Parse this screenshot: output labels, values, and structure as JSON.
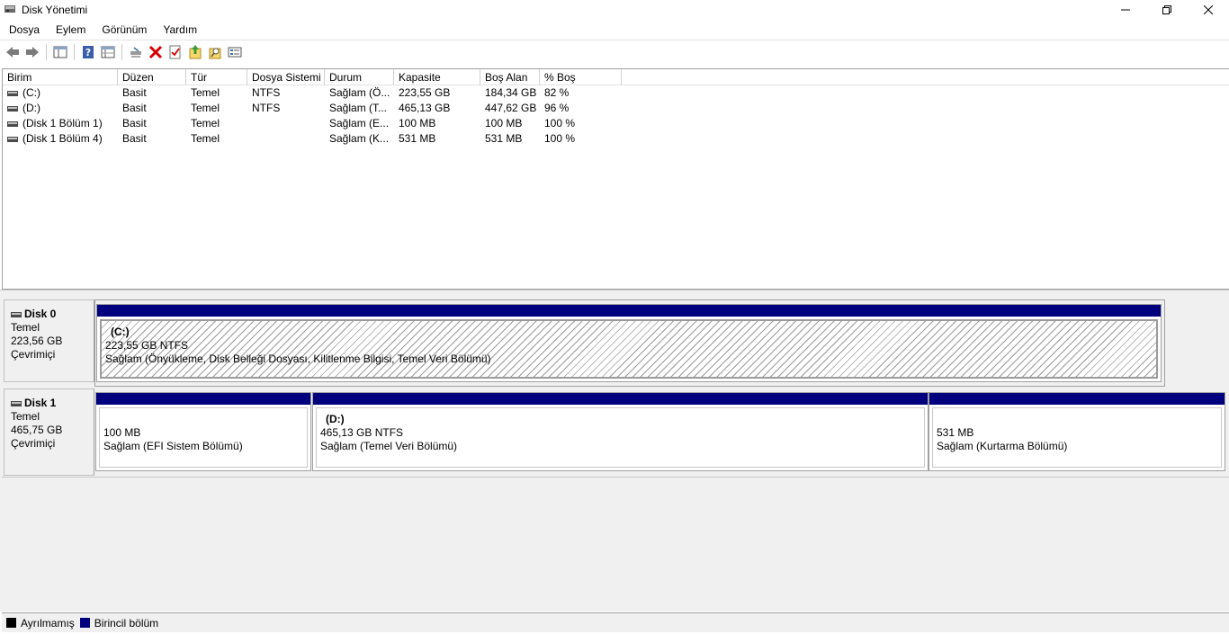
{
  "window": {
    "title": "Disk Yönetimi"
  },
  "menu": [
    "Dosya",
    "Eylem",
    "Görünüm",
    "Yardım"
  ],
  "toolbar": {
    "buttons": [
      "back-arrow-icon",
      "forward-arrow-icon",
      "console-tree-icon",
      "help-icon",
      "properties-grid-icon",
      "connect-disk-icon",
      "delete-icon",
      "check-icon",
      "export-icon",
      "find-icon",
      "list-view-icon"
    ]
  },
  "colors": {
    "primary_partition": "#00007f",
    "unallocated": "#000000"
  },
  "volume_list": {
    "columns": [
      "Birim",
      "Düzen",
      "Tür",
      "Dosya Sistemi",
      "Durum",
      "Kapasite",
      "Boş Alan",
      "% Boş"
    ],
    "rows": [
      [
        "(C:)",
        "Basit",
        "Temel",
        "NTFS",
        "Sağlam (Ö...",
        "223,55 GB",
        "184,34 GB",
        "82 %"
      ],
      [
        "(D:)",
        "Basit",
        "Temel",
        "NTFS",
        "Sağlam (T...",
        "465,13 GB",
        "447,62 GB",
        "96 %"
      ],
      [
        "(Disk 1 Bölüm 1)",
        "Basit",
        "Temel",
        "",
        "Sağlam (E...",
        "100 MB",
        "100 MB",
        "100 %"
      ],
      [
        "(Disk 1 Bölüm 4)",
        "Basit",
        "Temel",
        "",
        "Sağlam (K...",
        "531 MB",
        "531 MB",
        "100 %"
      ]
    ]
  },
  "disks": [
    {
      "name": "Disk 0",
      "type": "Temel",
      "size": "223,56 GB",
      "status": "Çevrimiçi",
      "partitions": [
        {
          "volume": "(C:)",
          "size": "223,55 GB NTFS",
          "status": "Sağlam (Önyükleme, Disk Belleği Dosyası, Kilitlenme Bilgisi, Temel Veri Bölümü)"
        }
      ]
    },
    {
      "name": "Disk 1",
      "type": "Temel",
      "size": "465,75 GB",
      "status": "Çevrimiçi",
      "partitions": [
        {
          "volume": "",
          "size": "100 MB",
          "status": "Sağlam (EFI Sistem Bölümü)"
        },
        {
          "volume": "(D:)",
          "size": "465,13 GB NTFS",
          "status": "Sağlam (Temel Veri Bölümü)"
        },
        {
          "volume": "",
          "size": "531 MB",
          "status": "Sağlam (Kurtarma Bölümü)"
        }
      ]
    }
  ],
  "legend": [
    "Ayrılmamış",
    "Birincil bölüm"
  ]
}
